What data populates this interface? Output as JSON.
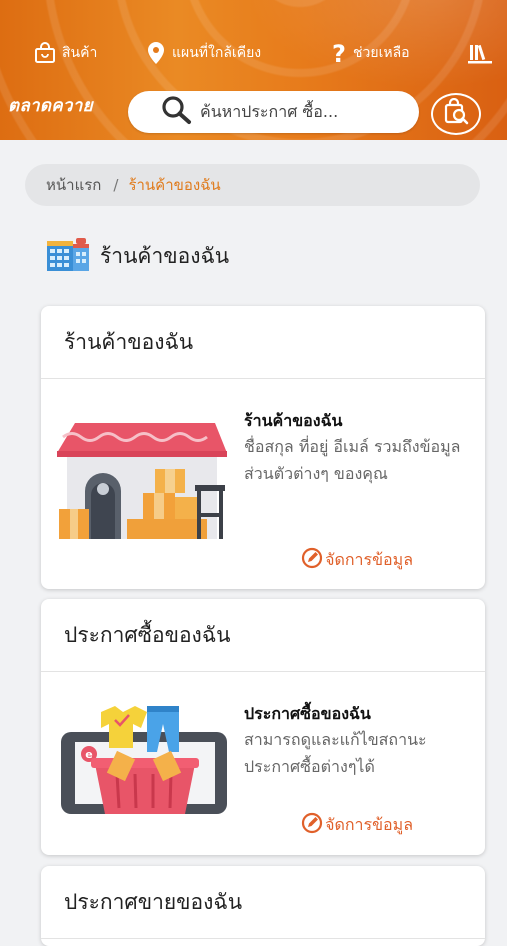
{
  "nav": {
    "products": "สินค้า",
    "nearby_map": "แผนที่ใกล้เคียง",
    "help": "ช่วยเหลือ"
  },
  "brand": "ตลาดควาย",
  "search": {
    "placeholder": "ค้นหาประกาศ ซื้อ..."
  },
  "breadcrumb": {
    "home": "หน้าแรก",
    "separator": "/",
    "current": "ร้านค้าของฉัน"
  },
  "page_title": "ร้านค้าของฉัน",
  "cards": [
    {
      "header": "ร้านค้าของฉัน",
      "title": "ร้านค้าของฉัน",
      "description": "ชื่อสกุล ที่อยู่ อีเมล์ รวมถึงข้อมูลส่วนตัวต่างๆ ของคุณ",
      "action": "จัดการข้อมูล"
    },
    {
      "header": "ประกาศซื้อของฉัน",
      "title": "ประกาศซื้อของฉัน",
      "description": "สามารถดูและแก้ไขสถานะประกาศซื้อต่างๆได้",
      "action": "จัดการข้อมูล"
    },
    {
      "header": "ประกาศขายของฉัน"
    }
  ],
  "colors": {
    "accent": "#e07b1c",
    "header": "#e47a1a",
    "action": "#e0602a"
  },
  "icons": [
    "shopping-bag-icon",
    "map-pin-icon",
    "question-icon",
    "library-icon",
    "search-icon",
    "search-box-icon",
    "store-icon",
    "edit-icon"
  ]
}
